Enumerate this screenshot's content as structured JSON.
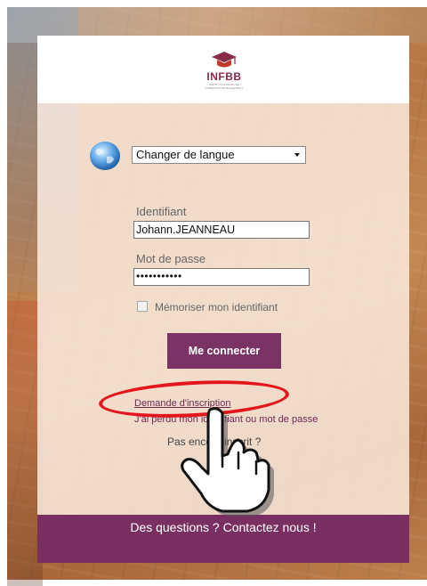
{
  "brand": {
    "name": "INFBB",
    "subtitle": "INSTITUT NATIONAL DE FORMATION DE BASKETBALL"
  },
  "language": {
    "selected": "Changer de langue",
    "icon": "globe-icon"
  },
  "login": {
    "identifier_label": "Identifiant",
    "identifier_value": "Johann.JEANNEAU",
    "password_label": "Mot de passe",
    "password_value": "•••••••••••",
    "remember_label": "Mémoriser mon identifiant",
    "remember_checked": false,
    "submit_label": "Me connecter"
  },
  "links": {
    "signup_request": "Demande d'inscription",
    "forgot": "J'ai perdu mon identifiant ou mot de passe",
    "not_registered": "Pas encore inscrit ?"
  },
  "footer": {
    "contact": "Des questions ? Contactez nous !"
  },
  "colors": {
    "brand_purple": "#7a2f62",
    "highlight_red": "#e3151d"
  }
}
